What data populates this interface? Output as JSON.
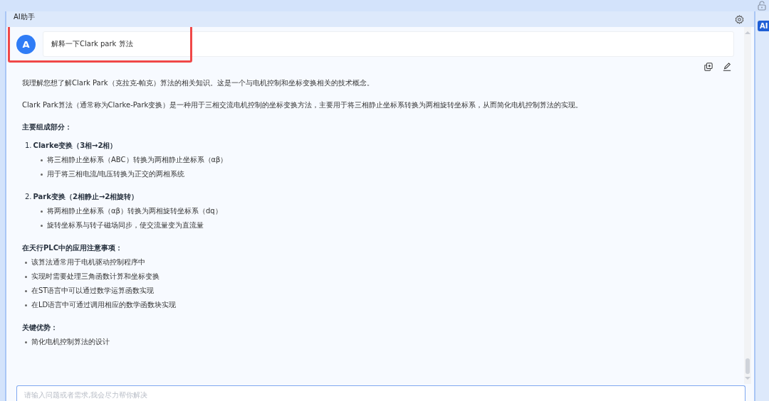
{
  "panel": {
    "title": "AI助手"
  },
  "rail": {
    "badge": "AI"
  },
  "user_message": {
    "avatar": "A",
    "text": "解释一下Clark park 算法"
  },
  "answer": [
    {
      "kind": "paragraph",
      "text": "我理解您想了解Clark Park（克拉克-帕克）算法的相关知识。这是一个与电机控制和坐标变换相关的技术概念。"
    },
    {
      "kind": "paragraph",
      "text": "Clark Park算法（通常称为Clarke-Park变换）是一种用于三相交流电机控制的坐标变换方法，主要用于将三相静止坐标系转换为两相旋转坐标系，从而简化电机控制算法的实现。"
    },
    {
      "kind": "heading",
      "text": "主要组成部分："
    },
    {
      "kind": "numbered",
      "number": "1.",
      "title": "Clarke变换（3相→2相）",
      "bullets": [
        "将三相静止坐标系（ABC）转换为两相静止坐标系（αβ）",
        "用于将三相电流/电压转换为正交的两相系统"
      ]
    },
    {
      "kind": "numbered",
      "number": "2.",
      "title": "Park变换（2相静止→2相旋转）",
      "bullets": [
        "将两相静止坐标系（αβ）转换为两相旋转坐标系（dq）",
        "旋转坐标系与转子磁场同步，使交流量变为直流量"
      ]
    },
    {
      "kind": "heading",
      "text": "在天行PLC中的应用注意事项："
    },
    {
      "kind": "bullets",
      "bullets": [
        "该算法通常用于电机驱动控制程序中",
        "实现时需要处理三角函数计算和坐标变换",
        "在ST语言中可以通过数学运算函数实现",
        "在LD语言中可通过调用相应的数学函数块实现"
      ]
    },
    {
      "kind": "heading",
      "text": "关键优势："
    },
    {
      "kind": "bullets",
      "bullets": [
        "简化电机控制算法的设计"
      ]
    }
  ],
  "input": {
    "placeholder": "请输入问题或者需求,我会尽力帮你解决"
  }
}
